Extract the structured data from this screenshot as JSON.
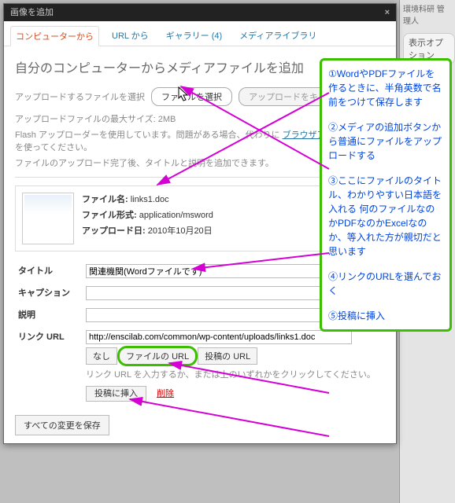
{
  "wpback": {
    "crumb": "環境科研 管理人",
    "opt": "表示オプション"
  },
  "modal": {
    "title": "画像を追加",
    "tabs": [
      "コンピューターから",
      "URL から",
      "ギャラリー (4)",
      "メディアライブラリ"
    ],
    "heading": "自分のコンピューターからメディアファイルを追加",
    "upload_label": "アップロードするファイルを選択",
    "choose_btn": "ファイルを選択",
    "cancel_btn": "アップロードをキャンセル",
    "maxsize": "アップロードファイルの最大サイズ: 2MB",
    "flash_a": "Flash アップローダーを使用しています。問題がある場合、代わりに",
    "flash_link": "ブラウザアップローダー",
    "flash_b": "を使ってください。",
    "after": "ファイルのアップロード完了後、タイトルと説明を追加できます。",
    "file": {
      "name_l": "ファイル名:",
      "name_v": "links1.doc",
      "type_l": "ファイル形式:",
      "type_v": "application/msword",
      "date_l": "アップロード日:",
      "date_v": "2010年10月20日"
    },
    "form": {
      "title_l": "タイトル",
      "title_v": "関連機関(Wordファイルです)",
      "caption_l": "キャプション",
      "desc_l": "説明",
      "url_l": "リンク URL",
      "url_v": "http://enscilab.com/common/wp-content/uploads/links1.doc",
      "url_none": "なし",
      "url_file": "ファイルの URL",
      "url_post": "投稿の URL",
      "url_hint": "リンク URL を入力するか、または上のいずれかをクリックしてください。",
      "insert": "投稿に挿入",
      "delete": "削除",
      "saveall": "すべての変更を保存"
    }
  },
  "callout": {
    "n1": "①WordやPDFファイルを作るときに、半角英数で名前をつけて保存します",
    "n2": "②メディアの追加ボタンから普通にファイルをアップロードする",
    "n3": "③ここにファイルのタイトル、わかりやすい日本語を入れる 何のファイルなのかPDFなのかExcelなのか、等入れた方が親切だと思います",
    "n4": "④リンクのURLを選んでおく",
    "n5": "⑤投稿に挿入"
  }
}
